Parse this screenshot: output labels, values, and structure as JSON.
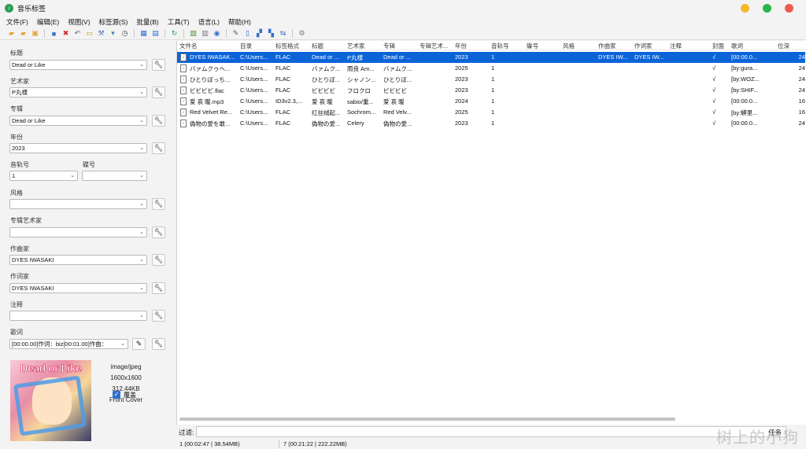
{
  "window": {
    "title": "音乐标签"
  },
  "menu": [
    "文件(F)",
    "编辑(E)",
    "视图(V)",
    "标签源(S)",
    "批量(B)",
    "工具(T)",
    "语言(L)",
    "帮助(H)"
  ],
  "toolbar_icons": [
    "open-folder-icon",
    "add-folder-icon",
    "add-files-icon",
    "save-icon",
    "delete-icon",
    "undo-icon",
    "book-icon",
    "tools-icon",
    "tag-icon",
    "clock-icon",
    "grid-icon",
    "grid-icon",
    "refresh-icon",
    "image-icon",
    "image-icon",
    "disc-icon",
    "magic-icon",
    "copy-icon",
    "split-icon",
    "move-icon",
    "rename-icon",
    "settings-icon"
  ],
  "left": {
    "title_label": "标题",
    "title_value": "Dead or Like",
    "artist_label": "艺术家",
    "artist_value": "P丸様",
    "album_label": "专辑",
    "album_value": "Dead or Like",
    "year_label": "年份",
    "year_value": "2023",
    "track_label": "音轨号",
    "track_value": "1",
    "disc_label": "碟号",
    "disc_value": "",
    "genre_label": "风格",
    "genre_value": "",
    "album_artist_label": "专辑艺术家",
    "album_artist_value": "",
    "composer_label": "作曲家",
    "composer_value": "DYES IWASAKI",
    "lyricist_label": "作词家",
    "lyricist_value": "DYES IWASAKI",
    "comment_label": "注释",
    "comment_value": "",
    "lyrics_label": "歌词",
    "lyrics_value": "[00:00.00]作词：biz[00:01.00]作曲：",
    "cover": {
      "art_text": "Dead or Like",
      "mime": "image/jpeg",
      "size": "1600x1600",
      "filesize": "312.44KB",
      "type": "Front Cover"
    },
    "overwrite_label": "覆盖",
    "overwrite_checked": true
  },
  "table": {
    "columns": [
      "文件名",
      "目录",
      "标签格式",
      "标题",
      "艺术家",
      "专辑",
      "专辑艺术...",
      "年份",
      "音轨号",
      "碟号",
      "风格",
      "作曲家",
      "作词家",
      "注释",
      "封面",
      "歌词",
      "位深"
    ],
    "rows": [
      [
        "DYES IWASAK...",
        "C:\\Users...",
        "FLAC",
        "Dead or ...",
        "P丸様",
        "Dead or ...",
        "",
        "2023",
        "1",
        "",
        "",
        "DYES IW...",
        "DYES IW...",
        "",
        "√",
        "[00:00.0...",
        "24"
      ],
      [
        "バァムクゥヘ...",
        "C:\\Users...",
        "FLAC",
        "バァムク...",
        "雨良 Am...",
        "バァムク...",
        "",
        "2025",
        "1",
        "",
        "",
        "",
        "",
        "",
        "√",
        "[by:gura...",
        "24"
      ],
      [
        "ひとりぼっち...",
        "C:\\Users...",
        "FLAC",
        "ひとりぼ...",
        "シャノン...",
        "ひとりぼ...",
        "",
        "2023",
        "1",
        "",
        "",
        "",
        "",
        "",
        "√",
        "[by:WOZ...",
        "24"
      ],
      [
        "ビビビビ.flac",
        "C:\\Users...",
        "FLAC",
        "ビビビビ",
        "フロクロ",
        "ビビビビ",
        "",
        "2023",
        "1",
        "",
        "",
        "",
        "",
        "",
        "√",
        "[by:SHIF...",
        "24"
      ],
      [
        "爱 哀 暧.mp3",
        "C:\\Users...",
        "ID3v2.3,...",
        "爱 哀 暧",
        "sabio/重...",
        "爱 哀 暧",
        "",
        "2024",
        "1",
        "",
        "",
        "",
        "",
        "",
        "√",
        "[00:00.0...",
        "16"
      ],
      [
        "Red Velvet Re...",
        "C:\\Users...",
        "FLAC",
        "红丝绒起...",
        "Sochrom...",
        "Red Velv...",
        "",
        "2025",
        "1",
        "",
        "",
        "",
        "",
        "",
        "√",
        "[by:蟒里...",
        "16"
      ],
      [
        "偽物の愛を敢...",
        "C:\\Users...",
        "FLAC",
        "偽物の愛...",
        "Celery",
        "偽物の愛...",
        "",
        "2023",
        "1",
        "",
        "",
        "",
        "",
        "",
        "√",
        "[00:00.0...",
        "24"
      ]
    ]
  },
  "filter": {
    "label": "过滤:",
    "value": "",
    "task_label": "任务"
  },
  "status": {
    "selected": "1 (00:02:47 | 38.54MB)",
    "total": "7 (00:21:22 | 222.22MB)"
  },
  "watermark": "树上的小狗",
  "colors": {
    "selection": "#0a64d8",
    "close": "#ee5b4f",
    "maximize": "#2cb54a",
    "minimize": "#f5b72c"
  }
}
